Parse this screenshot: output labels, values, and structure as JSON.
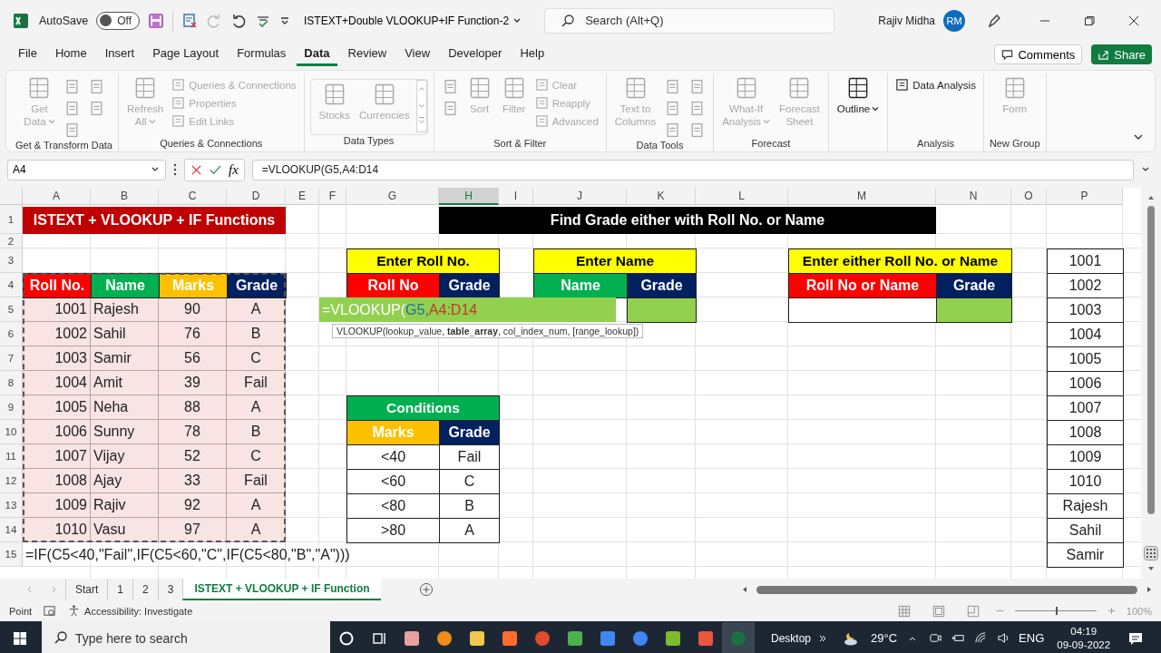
{
  "title_bar": {
    "autosave_label": "AutoSave",
    "autosave_state": "Off",
    "autosave_on": false,
    "document_title": "ISTEXT+Double VLOOKUP+IF Function-2",
    "search_placeholder": "Search (Alt+Q)",
    "user_name": "Rajiv Midha",
    "user_initials": "RM"
  },
  "menu_tabs": [
    {
      "label": "File",
      "selected": false
    },
    {
      "label": "Home",
      "selected": false
    },
    {
      "label": "Insert",
      "selected": false
    },
    {
      "label": "Page Layout",
      "selected": false
    },
    {
      "label": "Formulas",
      "selected": false
    },
    {
      "label": "Data",
      "selected": true
    },
    {
      "label": "Review",
      "selected": false
    },
    {
      "label": "View",
      "selected": false
    },
    {
      "label": "Developer",
      "selected": false
    },
    {
      "label": "Help",
      "selected": false
    }
  ],
  "comments_button": "Comments",
  "share_button": "Share",
  "ribbon_groups": [
    {
      "label": "Get & Transform Data",
      "columns": [
        [
          {
            "kind": "large",
            "label": "Get\nData",
            "dropdown": true,
            "disabled": true
          }
        ],
        [
          {
            "kind": "icon",
            "disabled": true
          },
          {
            "kind": "icon",
            "disabled": true
          },
          {
            "kind": "icon",
            "disabled": true
          }
        ],
        [
          {
            "kind": "icon",
            "disabled": true
          },
          {
            "kind": "icon",
            "disabled": true
          }
        ]
      ]
    },
    {
      "label": "Queries & Connections",
      "columns": [
        [
          {
            "kind": "large",
            "label": "Refresh\nAll",
            "dropdown": true,
            "disabled": true
          }
        ],
        [
          {
            "kind": "small",
            "label": "Queries & Connections",
            "disabled": true
          },
          {
            "kind": "small",
            "label": "Properties",
            "disabled": true
          },
          {
            "kind": "small",
            "label": "Edit Links",
            "disabled": true
          }
        ]
      ]
    },
    {
      "label": "Data Types",
      "gallery": true,
      "columns": [
        [
          {
            "kind": "large",
            "label": "Stocks",
            "disabled": true
          }
        ],
        [
          {
            "kind": "large",
            "label": "Currencies",
            "disabled": true
          }
        ]
      ]
    },
    {
      "label": "Sort & Filter",
      "columns": [
        [
          {
            "kind": "icon",
            "disabled": true
          },
          {
            "kind": "icon",
            "disabled": true
          }
        ],
        [
          {
            "kind": "large",
            "label": "Sort",
            "disabled": true
          }
        ],
        [
          {
            "kind": "large",
            "label": "Filter",
            "disabled": true
          }
        ],
        [
          {
            "kind": "small",
            "label": "Clear",
            "disabled": true
          },
          {
            "kind": "small",
            "label": "Reapply",
            "disabled": true
          },
          {
            "kind": "small",
            "label": "Advanced",
            "disabled": true
          }
        ]
      ]
    },
    {
      "label": "Data Tools",
      "columns": [
        [
          {
            "kind": "large",
            "label": "Text to\nColumns",
            "disabled": true
          }
        ],
        [
          {
            "kind": "icon",
            "disabled": true
          },
          {
            "kind": "icon",
            "disabled": true
          },
          {
            "kind": "icon",
            "disabled": true
          }
        ],
        [
          {
            "kind": "icon",
            "disabled": true
          },
          {
            "kind": "icon",
            "disabled": true
          },
          {
            "kind": "icon",
            "disabled": true
          }
        ]
      ]
    },
    {
      "label": "Forecast",
      "columns": [
        [
          {
            "kind": "large",
            "label": "What-If\nAnalysis",
            "dropdown": true,
            "disabled": true
          }
        ],
        [
          {
            "kind": "large",
            "label": "Forecast\nSheet",
            "disabled": true
          }
        ]
      ]
    },
    {
      "columns": [
        [
          {
            "kind": "large",
            "label": "Outline",
            "dropdown": true,
            "disabled": false
          }
        ]
      ]
    },
    {
      "label": "Analysis",
      "columns": [
        [
          {
            "kind": "small",
            "label": "Data Analysis",
            "disabled": false
          }
        ]
      ]
    },
    {
      "label": "New Group",
      "columns": [
        [
          {
            "kind": "large",
            "label": "Form",
            "disabled": true
          }
        ]
      ]
    }
  ],
  "formula_bar": {
    "name_box": "A4",
    "function_label": "fx",
    "formula": "=VLOOKUP(G5,A4:D14"
  },
  "columns": [
    {
      "label": "A",
      "selected": false
    },
    {
      "label": "B",
      "selected": false
    },
    {
      "label": "C",
      "selected": false
    },
    {
      "label": "D",
      "selected": false
    },
    {
      "label": "E",
      "selected": false
    },
    {
      "label": "F",
      "selected": false
    },
    {
      "label": "G",
      "selected": false
    },
    {
      "label": "H",
      "selected": true
    },
    {
      "label": "I",
      "selected": false
    },
    {
      "label": "J",
      "selected": false
    },
    {
      "label": "K",
      "selected": false
    },
    {
      "label": "L",
      "selected": false
    },
    {
      "label": "M",
      "selected": false
    },
    {
      "label": "N",
      "selected": false
    },
    {
      "label": "O",
      "selected": false
    },
    {
      "label": "P",
      "selected": false
    }
  ],
  "rows": [
    "1",
    "2",
    "3",
    "4",
    "5",
    "6",
    "7",
    "8",
    "9",
    "10",
    "11",
    "12",
    "13",
    "14",
    "15"
  ],
  "sheet": {
    "banner_left": {
      "text": "ISTEXT + VLOOKUP + IF Functions",
      "color": "#c00000"
    },
    "banner_right": {
      "text": "Find Grade either with Roll No. or Name",
      "color": "#000000"
    },
    "student_table": {
      "marquee": true,
      "headers": [
        {
          "label": "Roll No.",
          "color": "#ff0000"
        },
        {
          "label": "Name",
          "color": "#00b050"
        },
        {
          "label": "Marks",
          "color": "#ffc000"
        },
        {
          "label": "Grade",
          "color": "#002060"
        }
      ],
      "rows": [
        [
          "1001",
          "Rajesh",
          "90",
          "A"
        ],
        [
          "1002",
          "Sahil",
          "76",
          "B"
        ],
        [
          "1003",
          "Samir",
          "56",
          "C"
        ],
        [
          "1004",
          "Amit",
          "39",
          "Fail"
        ],
        [
          "1005",
          "Neha",
          "88",
          "A"
        ],
        [
          "1006",
          "Sunny",
          "78",
          "B"
        ],
        [
          "1007",
          "Vijay",
          "52",
          "C"
        ],
        [
          "1008",
          "Ajay",
          "33",
          "Fail"
        ],
        [
          "1009",
          "Rajiv",
          "92",
          "A"
        ],
        [
          "1010",
          "Vasu",
          "97",
          "A"
        ]
      ]
    },
    "lookup_boxes": [
      {
        "title": {
          "text": "Enter Roll No.",
          "color": "#ffff00"
        },
        "headers": [
          {
            "label": "Roll No",
            "color": "#ff0000"
          },
          {
            "label": "Grade",
            "color": "#002060"
          }
        ]
      },
      {
        "title": {
          "text": "Enter Name",
          "color": "#ffff00"
        },
        "headers": [
          {
            "label": "Name",
            "color": "#00b050"
          },
          {
            "label": "Grade",
            "color": "#002060"
          }
        ],
        "inputs": [
          {
            "color": "#92d050"
          }
        ]
      },
      {
        "title": {
          "text": "Enter either Roll No. or Name",
          "color": "#ffff00"
        },
        "headers": [
          {
            "label": "Roll No or Name",
            "color": "#ff0000"
          },
          {
            "label": "Grade",
            "color": "#002060"
          }
        ],
        "inputs": [
          {
            "color": "#ffffff"
          },
          {
            "color": "#92d050"
          }
        ]
      }
    ],
    "cell_editor": {
      "parts": [
        {
          "text": "=VLOOKUP(",
          "color": "#ffffff"
        },
        {
          "text": "G5,",
          "color": "#1f6f9f"
        },
        {
          "text": "A4:D14",
          "color": "#c0392b"
        }
      ]
    },
    "tooltip": "VLOOKUP(lookup_value, **table_array**, col_index_num, [range_lookup])",
    "conditions": {
      "title": {
        "text": "Conditions",
        "color": "#00b050"
      },
      "headers": [
        {
          "label": "Marks",
          "color": "#ffc000"
        },
        {
          "label": "Grade",
          "color": "#002060"
        }
      ],
      "rows": [
        [
          "<40",
          "Fail"
        ],
        [
          "<60",
          "C"
        ],
        [
          "<80",
          "B"
        ],
        [
          ">80",
          "A"
        ]
      ]
    },
    "side_list": [
      "1001",
      "1002",
      "1003",
      "1004",
      "1005",
      "1006",
      "1007",
      "1008",
      "1009",
      "1010",
      "Rajesh",
      "Sahil",
      "Samir"
    ],
    "note_formula": "=IF(C5<40,\"Fail\",IF(C5<60,\"C\",IF(C5<80,\"B\",\"A\")))"
  },
  "sheet_tabs": [
    {
      "label": "Start",
      "selected": false
    },
    {
      "label": "1",
      "selected": false
    },
    {
      "label": "2",
      "selected": false
    },
    {
      "label": "3",
      "selected": false
    },
    {
      "label": "ISTEXT + VLOOKUP + IF Function",
      "selected": true
    }
  ],
  "status_bar": {
    "mode": "Point",
    "accessibility": "Accessibility: Investigate",
    "zoom": "100%",
    "zoom_slider": {
      "level": 0.5
    }
  },
  "taskbar": {
    "search_placeholder": "Type here to search",
    "desktop_label": "Desktop",
    "temperature": "29°C",
    "language": "ENG",
    "time": "04:19",
    "date": "09-09-2022"
  }
}
